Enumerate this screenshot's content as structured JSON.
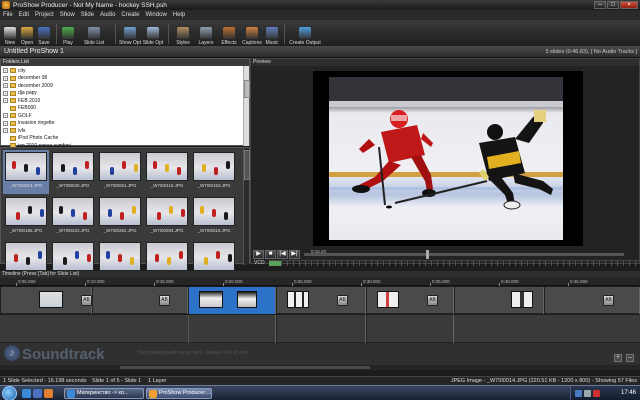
{
  "window": {
    "title": "ProShow Producer - Not My Name - hockey SSH.psh"
  },
  "menu": [
    "File",
    "Edit",
    "Project",
    "Show",
    "Slide",
    "Audio",
    "Create",
    "Window",
    "Help"
  ],
  "toolbar": [
    {
      "label": "New",
      "icon": "new-icon",
      "color": "#e0e0e0"
    },
    {
      "label": "Open",
      "icon": "open-folder-icon",
      "color": "#d8a840"
    },
    {
      "label": "Save",
      "icon": "save-icon",
      "color": "#4a70c0"
    },
    {
      "label": "Play",
      "icon": "play-icon",
      "color": "#4ab04a"
    },
    {
      "label": "Slide List",
      "icon": "slide-list-icon",
      "color": "#8090a8"
    },
    {
      "label": "Show Opt",
      "icon": "show-options-icon",
      "color": "#70a0d0"
    },
    {
      "label": "Slide Opt",
      "icon": "slide-options-icon",
      "color": "#a0b8d8"
    },
    {
      "label": "Styles",
      "icon": "styles-icon",
      "color": "#b09060"
    },
    {
      "label": "Layers",
      "icon": "layers-icon",
      "color": "#90a0b0"
    },
    {
      "label": "Effects",
      "icon": "effects-icon",
      "color": "#c07030"
    },
    {
      "label": "Captions",
      "icon": "captions-icon",
      "color": "#d08040"
    },
    {
      "label": "Music",
      "icon": "music-icon",
      "color": "#6080c0"
    },
    {
      "label": "Create Output",
      "icon": "create-output-icon",
      "color": "#50a0e0"
    }
  ],
  "project": {
    "name": "Untitled ProShow 1",
    "summary": "5 slides (0:46.83), [ No Audio Tracks ]"
  },
  "folders": {
    "header": "Folders List",
    "items": [
      {
        "label": "city",
        "expand": "+"
      },
      {
        "label": "december 08",
        "expand": "+"
      },
      {
        "label": "december 2009",
        "expand": "+"
      },
      {
        "label": "dja papy",
        "expand": "+"
      },
      {
        "label": "FEB 2010",
        "expand": "+"
      },
      {
        "label": "FEB000",
        "expand": ""
      },
      {
        "label": "GOLF",
        "expand": "+"
      },
      {
        "label": "invasion ringette",
        "expand": "+"
      },
      {
        "label": "ivfs",
        "expand": "+"
      },
      {
        "label": "iPod Photo Cache",
        "expand": ""
      },
      {
        "label": "jan 2010 papas symfoni",
        "expand": ""
      }
    ]
  },
  "thumbnails": [
    {
      "label": "_W7I00014.JPG",
      "selected": true
    },
    {
      "label": "_W7I00040.JPG",
      "selected": false
    },
    {
      "label": "_W7I00061.JPG",
      "selected": false
    },
    {
      "label": "_W7I00116.JPG",
      "selected": false
    },
    {
      "label": "_W7I00153.JPG",
      "selected": false
    },
    {
      "label": "_W7I00185.JPG",
      "selected": false
    },
    {
      "label": "_W7I00222.JPG",
      "selected": false
    },
    {
      "label": "_W7I00262.JPG",
      "selected": false
    },
    {
      "label": "_W7I00284.JPG",
      "selected": false
    },
    {
      "label": "_W7I00315.JPG",
      "selected": false
    },
    {
      "label": "",
      "selected": false
    },
    {
      "label": "",
      "selected": false
    },
    {
      "label": "",
      "selected": false
    },
    {
      "label": "",
      "selected": false
    },
    {
      "label": "",
      "selected": false
    }
  ],
  "preview": {
    "header": "Preview",
    "timestamp": "0:16.20",
    "vcd": "VCD"
  },
  "timeline": {
    "header": "Timeline (Press [Tab] for Slide List)",
    "ticks": [
      "0:05.000",
      "0:10.000",
      "0:15.000",
      "0:20.000",
      "0:25.000",
      "0:30.000",
      "0:35.000",
      "0:40.000",
      "0:45.000"
    ]
  },
  "soundtrack": {
    "label": "Soundtrack",
    "hint": "Drop background songs here.  Double click to edit."
  },
  "status": {
    "left": "1 Slide Selected - 16.198 seconds",
    "slide": "Slide 1 of 5 - Slide 1",
    "layers": "1 Layer",
    "right": "JPEG Image - _W7I00014.JPG (220.51 KB - 1200 x 800) - Showing 57 Files"
  },
  "taskbar": {
    "tasks": [
      "Материнство -> ко...",
      "ProShow Producer ..."
    ],
    "clock": "17:46"
  },
  "colors": {
    "accent": "#2b72c8",
    "selection": "#6a7fa8"
  }
}
